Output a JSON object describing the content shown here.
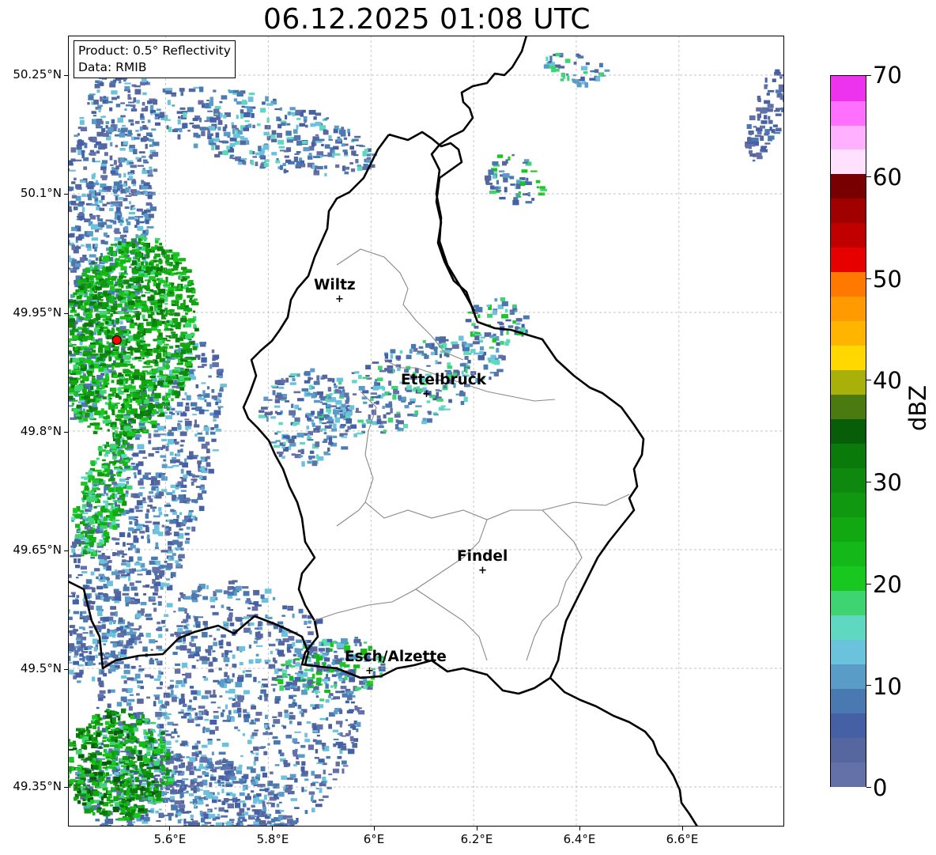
{
  "title": "06.12.2025 01:08 UTC",
  "info": {
    "product": "Product: 0.5° Reflectivity",
    "data": "Data: RMIB"
  },
  "lat_labels": [
    "50.25°N",
    "50.1°N",
    "49.95°N",
    "49.8°N",
    "49.65°N",
    "49.5°N",
    "49.35°N"
  ],
  "lon_labels": [
    "5.6°E",
    "5.8°E",
    "6°E",
    "6.2°E",
    "6.4°E",
    "6.6°E"
  ],
  "cities": [
    {
      "name": "Wiltz",
      "lon": 5.93,
      "lat": 49.97
    },
    {
      "name": "Ettelbruck",
      "lon": 6.1,
      "lat": 49.85
    },
    {
      "name": "Findel",
      "lon": 6.21,
      "lat": 49.63
    },
    {
      "name": "Esch/Alzette",
      "lon": 5.99,
      "lat": 49.5
    }
  ],
  "radar_site": {
    "lon": 5.505,
    "lat": 49.915,
    "color": "#ff0000"
  },
  "map_extent": {
    "lon": [
      5.41,
      6.805
    ],
    "lat": [
      49.3,
      50.3
    ]
  },
  "colorbar": {
    "units": "dBZ",
    "range": [
      0,
      70
    ],
    "tick_labels": [
      "0",
      "10",
      "20",
      "30",
      "40",
      "50",
      "60",
      "70"
    ],
    "colors": [
      "#6470a8",
      "#56679f",
      "#4660a6",
      "#4a78b0",
      "#5a9cc8",
      "#6ac2dc",
      "#5ed8c0",
      "#3fd472",
      "#18c81e",
      "#14b818",
      "#12a812",
      "#109810",
      "#0e880e",
      "#0a7a0a",
      "#085e08",
      "#4a7a10",
      "#aab00a",
      "#ffd800",
      "#ffb400",
      "#ff9a00",
      "#ff7800",
      "#e60000",
      "#c00000",
      "#a00000",
      "#780000",
      "#ffe0ff",
      "#ffb0ff",
      "#ff70ff",
      "#ee33ee"
    ]
  },
  "icons": {
    "city_marker": "plus-icon",
    "radar_site": "radar-dot-icon"
  }
}
